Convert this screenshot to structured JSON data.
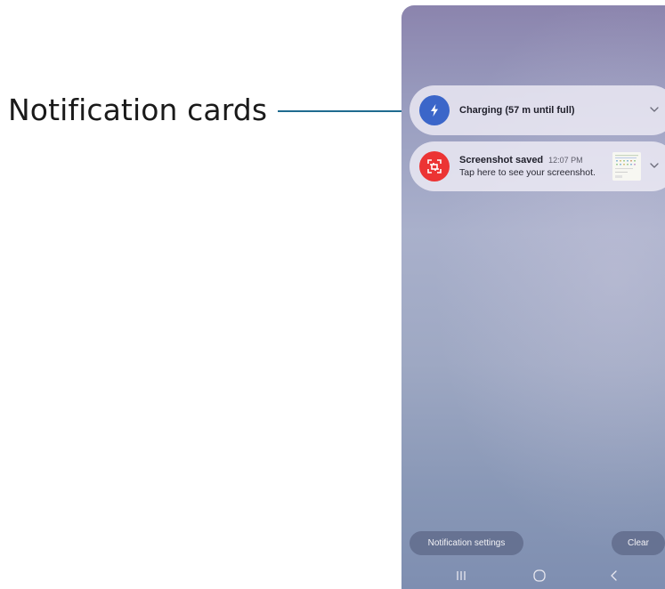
{
  "callout": {
    "label": "Notification cards"
  },
  "colors": {
    "callout_line": "#1f6b8f",
    "charging_icon_bg": "#3b66c9",
    "screenshot_icon_bg": "#ec3434",
    "card_bg": "#f0eef6",
    "pill_bg": "#626c8c"
  },
  "notifications": [
    {
      "icon": "lightning-bolt-icon",
      "title": "Charging (57 m until full)",
      "time": "",
      "body": "",
      "expand_icon": "chevron-down-icon"
    },
    {
      "icon": "screenshot-icon",
      "title": "Screenshot saved",
      "time": "12:07 PM",
      "body": "Tap here to see your screenshot.",
      "thumbnail": "screenshot-thumbnail",
      "expand_icon": "chevron-down-icon"
    }
  ],
  "footer": {
    "settings_label": "Notification settings",
    "clear_label": "Clear"
  },
  "navbar": {
    "items": [
      "recent-apps-icon",
      "home-icon",
      "back-icon"
    ]
  }
}
